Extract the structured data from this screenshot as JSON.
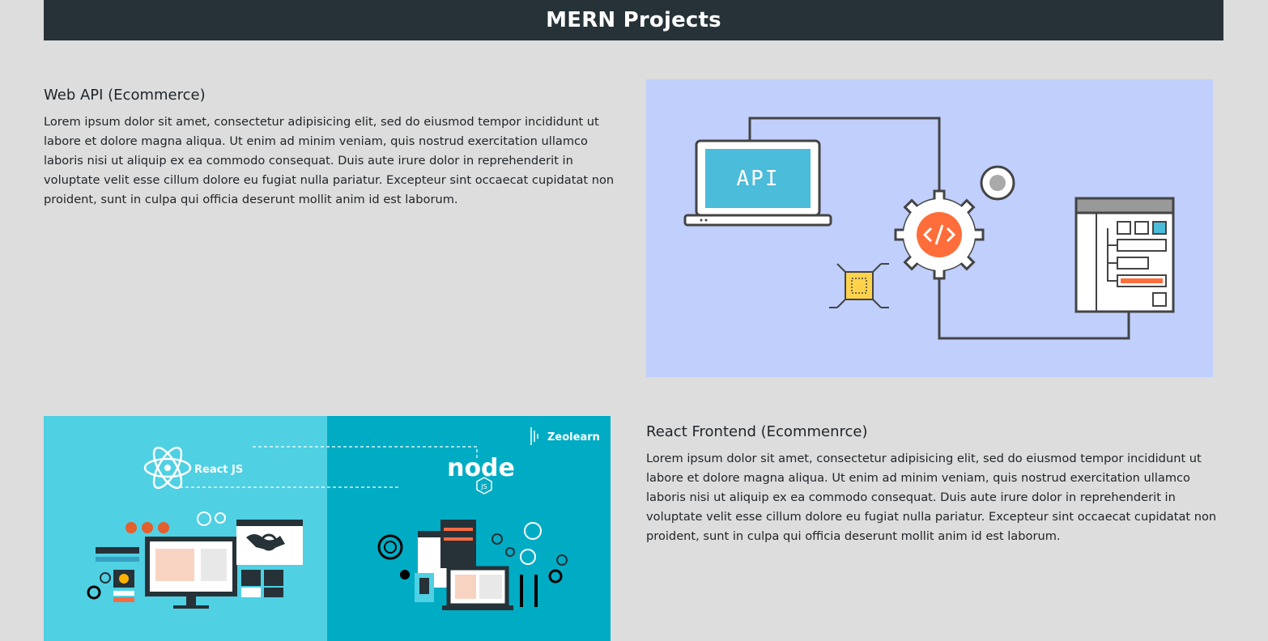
{
  "header": {
    "title": "MERN Projects"
  },
  "projects": [
    {
      "title": "Web API (Ecommerce)",
      "description": "Lorem ipsum dolor sit amet, consectetur adipisicing elit, sed do eiusmod tempor incididunt ut labore et dolore magna aliqua. Ut enim ad minim veniam, quis nostrud exercitation ullamco laboris nisi ut aliquip ex ea commodo consequat. Duis aute irure dolor in reprehenderit in voluptate velit esse cillum dolore eu fugiat nulla pariatur. Excepteur sint occaecat cupidatat non proident, sunt in culpa qui officia deserunt mollit anim id est laborum.",
      "image": {
        "icon": "api-illustration",
        "screen_text": "API"
      }
    },
    {
      "title": "React Frontend (Ecommenrce)",
      "description": "Lorem ipsum dolor sit amet, consectetur adipisicing elit, sed do eiusmod tempor incididunt ut labore et dolore magna aliqua. Ut enim ad minim veniam, quis nostrud exercitation ullamco laboris nisi ut aliquip ex ea commodo consequat. Duis aute irure dolor in reprehenderit in voluptate velit esse cillum dolore eu fugiat nulla pariatur. Excepteur sint occaecat cupidatat non proident, sunt in culpa qui officia deserunt mollit anim id est laborum.",
      "image": {
        "icon": "react-node-illustration",
        "react_label": "React JS",
        "node_label": "node",
        "node_sub": "JS",
        "brand": "Zeolearn"
      }
    }
  ]
}
